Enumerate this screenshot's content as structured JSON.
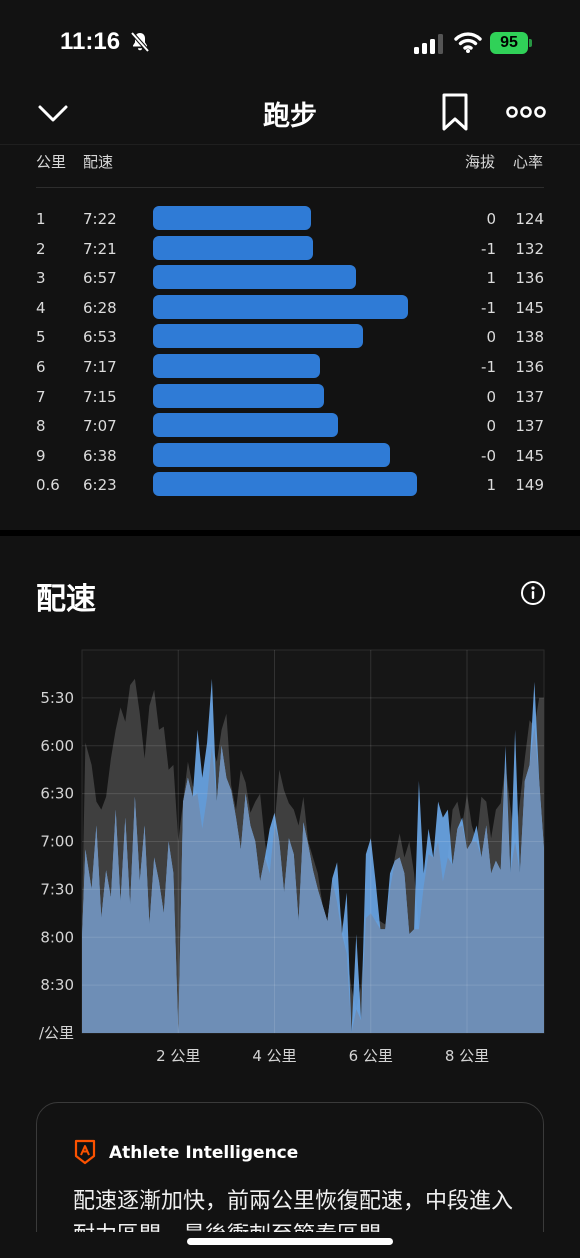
{
  "status_bar": {
    "time": "11:16",
    "battery": "95"
  },
  "nav": {
    "title": "跑步"
  },
  "splits": {
    "headers": {
      "km": "公里",
      "pace": "配速",
      "elevation": "海拔",
      "heart_rate": "心率"
    },
    "rows": [
      {
        "km": "1",
        "pace": "7:22",
        "pace_seconds": 442,
        "elevation": "0",
        "heart_rate": "124"
      },
      {
        "km": "2",
        "pace": "7:21",
        "pace_seconds": 441,
        "elevation": "-1",
        "heart_rate": "132"
      },
      {
        "km": "3",
        "pace": "6:57",
        "pace_seconds": 417,
        "elevation": "1",
        "heart_rate": "136"
      },
      {
        "km": "4",
        "pace": "6:28",
        "pace_seconds": 388,
        "elevation": "-1",
        "heart_rate": "145"
      },
      {
        "km": "5",
        "pace": "6:53",
        "pace_seconds": 413,
        "elevation": "0",
        "heart_rate": "138"
      },
      {
        "km": "6",
        "pace": "7:17",
        "pace_seconds": 437,
        "elevation": "-1",
        "heart_rate": "136"
      },
      {
        "km": "7",
        "pace": "7:15",
        "pace_seconds": 435,
        "elevation": "0",
        "heart_rate": "137"
      },
      {
        "km": "8",
        "pace": "7:07",
        "pace_seconds": 427,
        "elevation": "0",
        "heart_rate": "137"
      },
      {
        "km": "9",
        "pace": "6:38",
        "pace_seconds": 398,
        "elevation": "-0",
        "heart_rate": "145"
      },
      {
        "km": "0.6",
        "pace": "6:23",
        "pace_seconds": 383,
        "elevation": "1",
        "heart_rate": "149"
      }
    ]
  },
  "pace_section": {
    "title": "配速"
  },
  "chart_data": {
    "type": "area",
    "title": "",
    "y_unit": "/公里",
    "y_ticks": [
      "5:30",
      "6:00",
      "6:30",
      "7:00",
      "7:30",
      "8:00",
      "8:30"
    ],
    "y_tick_seconds": [
      330,
      360,
      390,
      420,
      450,
      480,
      510
    ],
    "ylim_seconds": [
      540,
      300
    ],
    "x_ticks": [
      "2 公里",
      "4 公里",
      "6 公里",
      "8 公里"
    ],
    "x_tick_values": [
      2,
      4,
      6,
      8
    ],
    "xlim": [
      0,
      9.6
    ],
    "grid": true,
    "series": [
      {
        "x": [
          0,
          0.07,
          0.2,
          0.3,
          0.4,
          0.5,
          0.6,
          0.7,
          0.8,
          0.9,
          1.0,
          1.1,
          1.2,
          1.3,
          1.4,
          1.5,
          1.6,
          1.7,
          1.8,
          1.9,
          2.0,
          2.1,
          2.2,
          2.3,
          2.4,
          2.5,
          2.6,
          2.7,
          2.8,
          2.9,
          3.0,
          3.1,
          3.2,
          3.3,
          3.4,
          3.5,
          3.6,
          3.7,
          3.8,
          3.9,
          4.0,
          4.1,
          4.2,
          4.3,
          4.4,
          4.5,
          4.6,
          4.7,
          4.8,
          4.9,
          5.0,
          5.1,
          5.2,
          5.3,
          5.4,
          5.5,
          5.6,
          5.7,
          5.8,
          5.9,
          6.0,
          6.1,
          6.2,
          6.3,
          6.4,
          6.5,
          6.6,
          6.7,
          6.8,
          6.9,
          7.0,
          7.1,
          7.2,
          7.3,
          7.4,
          7.5,
          7.6,
          7.7,
          7.8,
          7.9,
          8.0,
          8.1,
          8.2,
          8.3,
          8.4,
          8.5,
          8.6,
          8.7,
          8.8,
          8.9,
          9.0,
          9.1,
          9.2,
          9.3,
          9.4,
          9.5,
          9.6
        ],
        "pace_seconds": [
          470,
          358,
          372,
          395,
          400,
          392,
          368,
          350,
          336,
          345,
          322,
          318,
          340,
          368,
          335,
          325,
          350,
          348,
          375,
          372,
          420,
          395,
          370,
          385,
          390,
          412,
          392,
          360,
          370,
          350,
          340,
          385,
          400,
          375,
          383,
          402,
          395,
          390,
          420,
          440,
          410,
          375,
          388,
          396,
          400,
          410,
          392,
          420,
          430,
          440,
          460,
          470,
          445,
          458,
          470,
          490,
          512,
          525,
          510,
          468,
          465,
          470,
          470,
          472,
          450,
          430,
          415,
          430,
          420,
          440,
          475,
          448,
          428,
          430,
          420,
          445,
          430,
          400,
          395,
          410,
          390,
          410,
          420,
          392,
          395,
          418,
          400,
          396,
          372,
          398,
          420,
          395,
          368,
          344,
          348,
          330,
          330
        ],
        "color": "#3f3f3f"
      },
      {
        "x": [
          0,
          0.07,
          0.2,
          0.3,
          0.4,
          0.5,
          0.6,
          0.7,
          0.8,
          0.9,
          1.0,
          1.1,
          1.2,
          1.3,
          1.4,
          1.5,
          1.6,
          1.7,
          1.8,
          1.9,
          2.0,
          2.1,
          2.2,
          2.3,
          2.4,
          2.5,
          2.6,
          2.7,
          2.8,
          2.9,
          3.0,
          3.1,
          3.2,
          3.3,
          3.4,
          3.5,
          3.6,
          3.7,
          3.8,
          3.9,
          4.0,
          4.1,
          4.2,
          4.3,
          4.4,
          4.5,
          4.6,
          4.7,
          4.8,
          4.9,
          5.0,
          5.1,
          5.2,
          5.3,
          5.4,
          5.5,
          5.6,
          5.7,
          5.8,
          5.9,
          6.0,
          6.1,
          6.2,
          6.3,
          6.4,
          6.5,
          6.6,
          6.7,
          6.8,
          6.9,
          7.0,
          7.1,
          7.2,
          7.3,
          7.4,
          7.5,
          7.6,
          7.7,
          7.8,
          7.9,
          8.0,
          8.1,
          8.2,
          8.3,
          8.4,
          8.5,
          8.6,
          8.7,
          8.8,
          8.9,
          9.0,
          9.1,
          9.2,
          9.3,
          9.4,
          9.5,
          9.6
        ],
        "pace_seconds": [
          480,
          425,
          450,
          410,
          468,
          438,
          455,
          400,
          458,
          405,
          460,
          392,
          445,
          410,
          472,
          430,
          445,
          465,
          420,
          440,
          540,
          395,
          380,
          392,
          350,
          380,
          358,
          318,
          395,
          360,
          380,
          388,
          405,
          425,
          390,
          410,
          420,
          445,
          430,
          412,
          402,
          420,
          452,
          418,
          428,
          470,
          408,
          422,
          438,
          450,
          460,
          470,
          443,
          433,
          478,
          452,
          540,
          478,
          532,
          428,
          418,
          445,
          475,
          475,
          440,
          432,
          430,
          440,
          478,
          475,
          382,
          440,
          412,
          430,
          395,
          405,
          400,
          435,
          412,
          405,
          425,
          420,
          410,
          430,
          410,
          440,
          432,
          438,
          360,
          440,
          350,
          440,
          382,
          372,
          320,
          382,
          425
        ],
        "color": "#6aa6e6"
      }
    ]
  },
  "ai_card": {
    "title": "Athlete Intelligence",
    "body": "配速逐漸加快，前兩公里恢復配速，中段進入耐力區間，最後衝刺至節奏區間"
  }
}
